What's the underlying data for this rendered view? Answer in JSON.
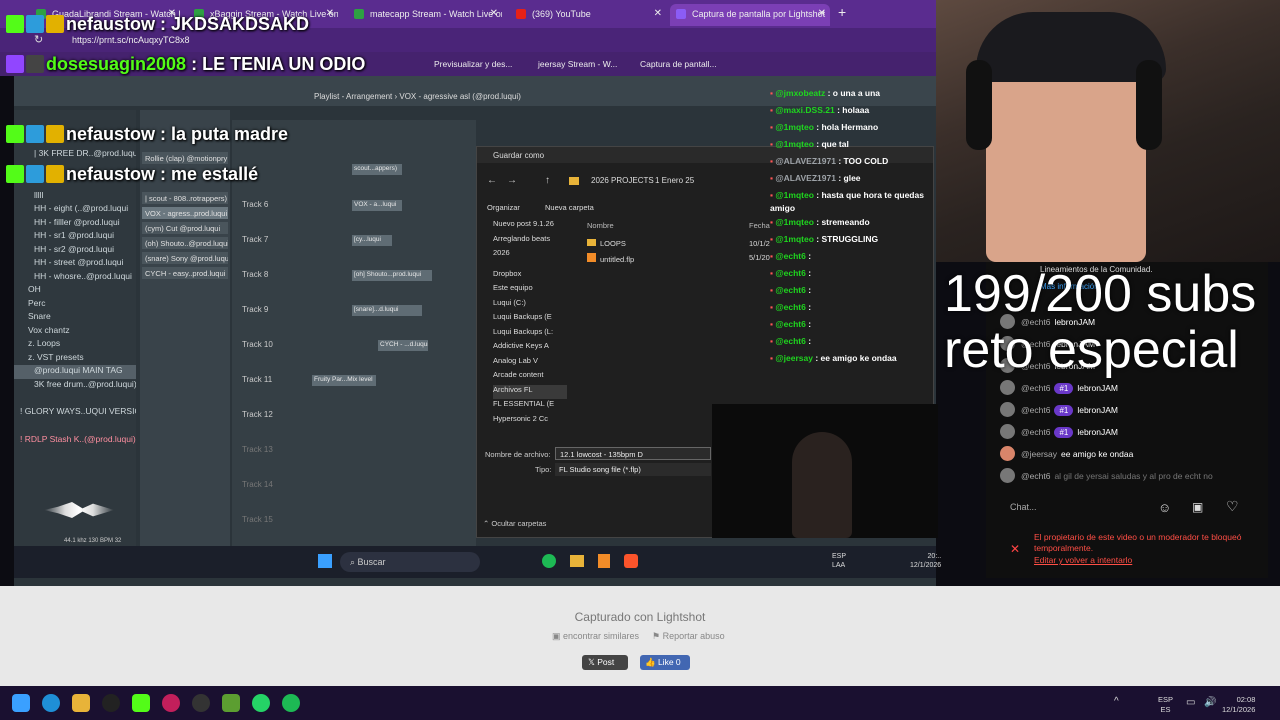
{
  "browser_tabs": [
    {
      "label": "GuadaLibrandi Stream - Watch Liv",
      "color": "#2ea043"
    },
    {
      "label": "xBaggin Stream - Watch Live on K",
      "color": "#2ea043"
    },
    {
      "label": "matecapp Stream - Watch Live on",
      "color": "#2ea043"
    },
    {
      "label": "(369) YouTube",
      "color": "#e62117"
    },
    {
      "label": "Captura de pantalla por Lightshot",
      "color": "#8b5cf6"
    }
  ],
  "new_tab": "+",
  "address": "https://prnt.sc/ncAuqxyTC8x8",
  "bookmarks": [
    "Previsualizar y des...",
    "jeersay Stream - W...",
    "Captura de pantall..."
  ],
  "overlay_chat": [
    {
      "user": "nefaustow",
      "text": ": JKDSAKDSAKD"
    },
    {
      "user": "dosesuagin2008",
      "text": ": LE TENIA UN ODIO"
    },
    {
      "user": "nefaustow",
      "text": ": la puta madre"
    },
    {
      "user": "nefaustow",
      "text": ": me estallé"
    }
  ],
  "fl": {
    "playlist_title": "Playlist - Arrangement › VOX - agressive asl (@prod.luqui)",
    "browser_items": [
      "| 3K FREE DR..@prod.luqui)",
      "lllll",
      "HH - eight (..@prod.luqui",
      "HH - filller @prod.luqui",
      "HH - sr1 @prod.luqui",
      "HH - sr2 @prod.luqui",
      "HH - street @prod.luqui",
      "HH - whosre..@prod.luqui",
      "OH",
      "Perc",
      "Snare",
      "Vox chantz",
      "z. Loops",
      "z. VST presets",
      "@prod.luqui MAIN TAG",
      "3K free drum..@prod.luqui)",
      "! GLORY WAYS..UQUI VERSION",
      "! RDLP Stash K..(@prod.luqui)"
    ],
    "channel_items": [
      "Rollie (clap) @motionpry",
      "| scout - 808..rotrappers)",
      "VOX - agress..prod.luqui",
      "(cym) Cut @prod.luqui",
      "(oh) Shouto..@prod.luqui",
      "(snare) Sony @prod.luqui",
      "CYCH - easy..prod.luqui"
    ],
    "tracks": [
      "Track 6",
      "Track 7",
      "Track 8",
      "Track 9",
      "Track 10",
      "Track 11",
      "Track 12",
      "Track 13",
      "Track 14",
      "Track 15"
    ],
    "clips": [
      "scout...appers)",
      "VOX - a...luqui",
      "[cy...luqui",
      "[oh] Shouto...prod.luqui",
      "[snare]...d.luqui",
      "CYCH - ...d.luqui",
      "Fruity Par...Mix level"
    ],
    "status": "44.1 khz 130 BPM 32"
  },
  "dialog": {
    "title": "Guardar como",
    "path": [
      "2026 PROJECTS",
      "1 Enero 25"
    ],
    "organize": "Organizar",
    "new_folder": "Nueva carpeta",
    "col_name": "Nombre",
    "col_date": "Fecha",
    "sidebar": [
      "Nuevo post 9.1.26",
      "Arreglando beats",
      "2026",
      "Dropbox",
      "Este equipo",
      "Luqui (C:)",
      "Luqui Backups (E",
      "Luqui Backups (L:",
      "Addictive Keys A",
      "Analog Lab V",
      "Arcade content",
      "Archivos FL",
      "FL ESSENTIAL (E",
      "Hypersonic 2 Cc"
    ],
    "files": [
      {
        "name": "LOOPS",
        "date": "10/1/2"
      },
      {
        "name": "untitled.flp",
        "date": "5/1/20"
      }
    ],
    "filename_label": "Nombre de archivo:",
    "filename_value": "12.1 lowcost - 135bpm D",
    "type_label": "Tipo:",
    "type_value": "FL Studio song file (*.flp)",
    "hide_folders": "Ocultar carpetas"
  },
  "twitch_chat": [
    {
      "user": "@jmxobeatz",
      "text": ": o una a una"
    },
    {
      "user": "@maxi.DSS.21",
      "text": ": holaaa"
    },
    {
      "user": "@1mqteo",
      "text": ": hola Hermano"
    },
    {
      "user": "@1mqteo",
      "text": ": que tal"
    },
    {
      "user": "@ALAVEZ1971",
      "text": ": TOO COLD"
    },
    {
      "user": "@ALAVEZ1971",
      "text": ": glee"
    },
    {
      "user": "@1mqteo",
      "text": ": hasta que hora te quedas"
    },
    {
      "user": "",
      "text": "amigo"
    },
    {
      "user": "@1mqteo",
      "text": ": stremeando"
    },
    {
      "user": "@1mqteo",
      "text": ": STRUGGLING"
    },
    {
      "user": "@echt6",
      "text": ":"
    },
    {
      "user": "@echt6",
      "text": ":"
    },
    {
      "user": "@echt6",
      "text": ":"
    },
    {
      "user": "@echt6",
      "text": ":"
    },
    {
      "user": "@echt6",
      "text": ":"
    },
    {
      "user": "@echt6",
      "text": ":"
    },
    {
      "user": "@jeersay",
      "text": ": ee amigo ke ondaa"
    }
  ],
  "subs": {
    "line1": "199/200 subs",
    "line2": "reto especial"
  },
  "youtube_chat": {
    "header": "Lineamientos de la Comunidad.",
    "link": "Más información",
    "messages": [
      {
        "name": "@echt6",
        "badge": "",
        "text": "lebronJAM"
      },
      {
        "name": "@echt6",
        "badge": "",
        "text": "lebronJAM"
      },
      {
        "name": "@echt6",
        "badge": "",
        "text": "lebronJAM"
      },
      {
        "name": "@echt6",
        "badge": "#1",
        "text": "lebronJAM"
      },
      {
        "name": "@echt6",
        "badge": "#1",
        "text": "lebronJAM"
      },
      {
        "name": "@echt6",
        "badge": "#1",
        "text": "lebronJAM"
      },
      {
        "name": "@jeersay",
        "badge": "",
        "text": "ee amigo ke ondaa"
      },
      {
        "name": "@echt6",
        "badge": "",
        "text": "al gil de yersai saludas y al pro de echt no"
      }
    ],
    "input_placeholder": "Chat...",
    "blocked_msg": "El propietario de este video o un moderador te bloqueó temporalmente.",
    "blocked_link": "Editar y volver a intentarlo"
  },
  "inner_taskbar": {
    "search": "Buscar",
    "lang": "ESP",
    "lang2": "LAA",
    "time": "20:..",
    "date": "12/1/2026"
  },
  "lightshot": {
    "captured": "Capturado con Lightshot",
    "similar": "encontrar similares",
    "report": "Reportar abuso",
    "post": "Post",
    "like": "Like 0"
  },
  "host_taskbar": {
    "lang": "ESP",
    "lang2": "ES",
    "time": "02:08",
    "date": "12/1/2026"
  },
  "colors": {
    "twitch_green": "#53fc18",
    "purple": "#6a38c9",
    "chrome": "#5a2c8f"
  }
}
